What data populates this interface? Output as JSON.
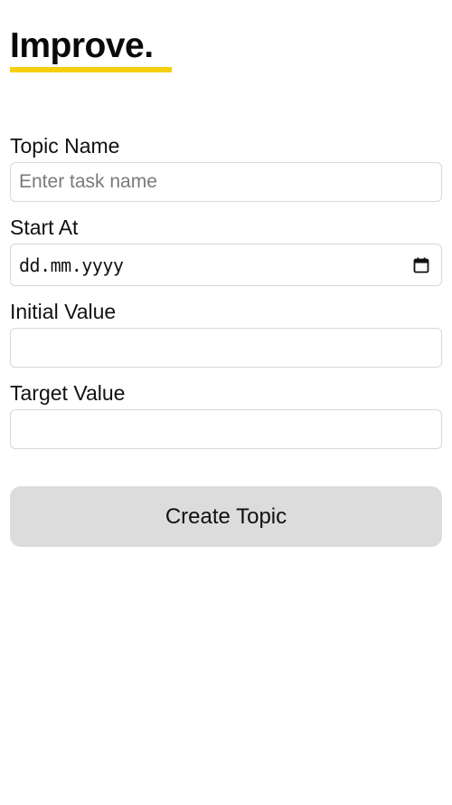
{
  "brand": {
    "title": "Improve.",
    "accent_color": "#f5cf0c"
  },
  "form": {
    "topic_name": {
      "label": "Topic Name",
      "placeholder": "Enter task name",
      "value": ""
    },
    "start_at": {
      "label": "Start At",
      "value": "dd.mm.yyyy",
      "icon": "calendar-icon"
    },
    "initial_value": {
      "label": "Initial Value",
      "value": ""
    },
    "target_value": {
      "label": "Target Value",
      "value": ""
    },
    "submit_label": "Create Topic"
  },
  "colors": {
    "button_background": "#dcdcdc",
    "input_border": "#d8d8d8"
  }
}
